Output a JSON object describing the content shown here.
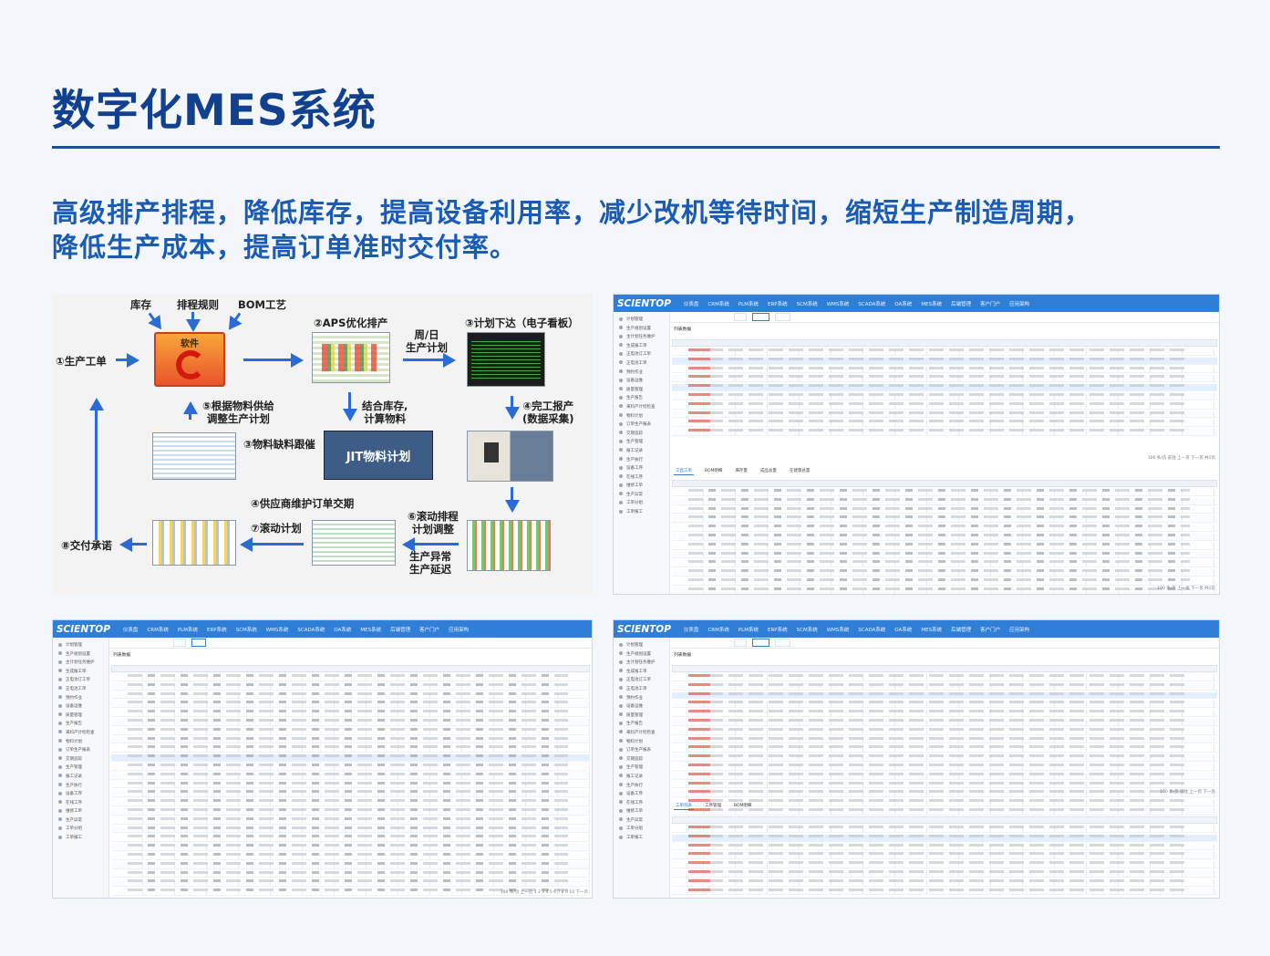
{
  "heading": "数字化MES系统",
  "subtitle_line1": "高级排产排程，降低库存，提高设备利用率，减少改机等待时间，缩短生产制造周期，",
  "subtitle_line2": "降低生产成本，提高订单准时交付率。",
  "flow": {
    "inventory": "库存",
    "scheduling_rules": "排程规则",
    "bom": "BOM工艺",
    "software": "软件",
    "aps": "②APS优化排产",
    "week_day_plan": "周/日\n生产计划",
    "plan_issue": "③计划下达（电子看板）",
    "work_order": "①生产工单",
    "material_supply": "⑤根据物料供给\n调整生产计划",
    "combine_stock": "结合库存,\n计算物料",
    "completion_report": "④完工报产\n(数据采集)",
    "shortage_tracking": "③物料缺料跟催",
    "jit": "JIT物料计划",
    "supplier_maintenance": "④供应商维护订单交期",
    "rolling_adjust": "⑥滚动排程\n计划调整",
    "rolling_plan": "⑦滚动计划",
    "delivery_commit": "⑧交付承诺",
    "production_exception": "生产异常\n生产延迟"
  },
  "app": {
    "logo": "SCIENTOP",
    "menu": [
      "仪表盘",
      "CRM系统",
      "PLM系统",
      "ERP系统",
      "SCM系统",
      "WMS系统",
      "SCADA系统",
      "OA系统",
      "MES系统",
      "后端管理",
      "客户门户",
      "应用架构"
    ],
    "sidebar": [
      "计划管理",
      "生产规划设置",
      "主计划任务维护",
      "生成报工单",
      "正电池订工单",
      "正电池工单",
      "预约作业",
      "设备运维",
      "质量管理",
      "生产报告",
      "来料产计检检查",
      "物料计划",
      "订单生产报表",
      "交期追踪",
      "生产管理",
      "报工记录",
      "生产执行",
      "设备工序",
      "在线工序",
      "维修工单",
      "生产异常",
      "工单分组",
      "工单报工"
    ],
    "a1": {
      "section": "列表数据",
      "subtabs": [
        "交直工单",
        "BOM明细",
        "库存量",
        "成品总量",
        "在建量总量"
      ],
      "pager1": "100 条/页  前往  上一页  下一页  共1页",
      "pager2": "100 条/页  上一页  下一页  共1页"
    },
    "a2": {
      "section": "列表数据",
      "pager": "100 条/页  上一页  1  2  3  4  5  6  7  8  9  10  下一页"
    },
    "a3": {
      "section": "列表数据",
      "subtabs": [
        "工单列表",
        "工序管理",
        "BOM明细"
      ],
      "pager": "100 条/页  前往  上一页  下一页"
    }
  }
}
